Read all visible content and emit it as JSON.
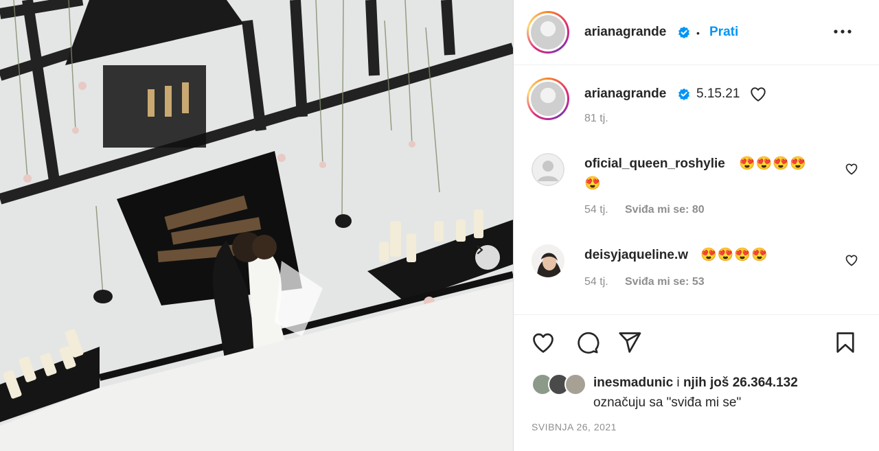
{
  "post": {
    "author": "arianagrande",
    "follow_label": "Prati",
    "separator": "•",
    "caption_date": "5.15.21",
    "caption_age": "81 tj.",
    "date": "SVIBNJA 26, 2021"
  },
  "comments": [
    {
      "user": "oficial_queen_roshylie",
      "emojis_line1": "😍😍😍😍",
      "emojis_line2": "😍",
      "age": "54 tj.",
      "likes": "Sviđa mi se: 80"
    },
    {
      "user": "deisyjaqueline.w",
      "emojis_line1": "😍😍😍😍",
      "age": "54 tj.",
      "likes": "Sviđa mi se: 53"
    }
  ],
  "likes": {
    "user": "inesmadunic",
    "connector": " i ",
    "rest": "njih još 26.364.132",
    "line2": "označuju sa \"sviđa mi se\""
  },
  "icons": {
    "verified": "verified-badge-icon",
    "more": "more-options-icon",
    "like": "heart-icon",
    "comment": "comment-icon",
    "share": "share-icon",
    "save": "bookmark-icon",
    "next": "chevron-right-icon"
  },
  "colors": {
    "accent": "#0095f6",
    "muted": "#8e8e8e"
  }
}
